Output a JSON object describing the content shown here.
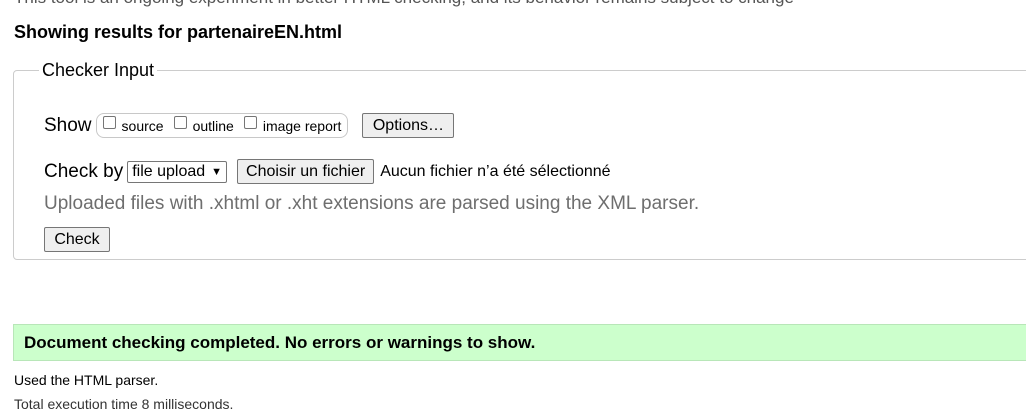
{
  "top_partial_text": "This tool is an ongoing experiment in better HTML checking, and its behavior remains subject to change",
  "results_heading": "Showing results for partenaireEN.html",
  "checker": {
    "legend": "Checker Input",
    "show_label": "Show",
    "show_options": [
      {
        "label": "source",
        "checked": false
      },
      {
        "label": "outline",
        "checked": false
      },
      {
        "label": "image report",
        "checked": false
      }
    ],
    "options_button": "Options…",
    "check_by_label": "Check by",
    "check_by_select": "file upload",
    "choose_file_button": "Choisir un fichier",
    "file_status": "Aucun fichier n’a été sélectionné",
    "note": "Uploaded files with .xhtml or .xht extensions are parsed using the XML parser.",
    "check_button": "Check"
  },
  "success_message": "Document checking completed. No errors or warnings to show.",
  "parser_note": "Used the HTML parser.",
  "bottom_partial_text": "Total execution time 8 milliseconds.",
  "colors": {
    "success_bg": "#ccffcc",
    "note_text": "#6e6e6e",
    "fieldset_border": "#cccccc"
  }
}
